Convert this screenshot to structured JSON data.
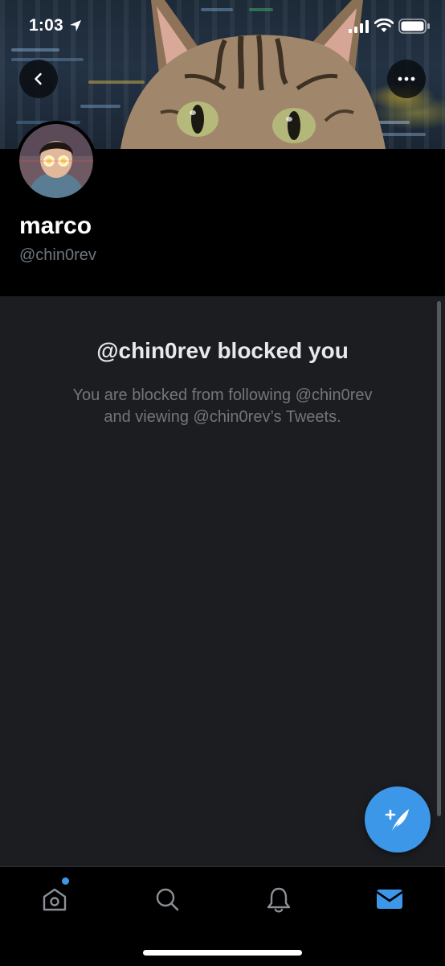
{
  "status_bar": {
    "time": "1:03"
  },
  "header": {
    "back_icon": "chevron-left-icon",
    "more_icon": "more-horizontal-icon"
  },
  "profile": {
    "name": "marco",
    "handle": "@chin0rev"
  },
  "blocked": {
    "title": "@chin0rev blocked you",
    "desc_line1": "You are blocked from following @chin0rev",
    "desc_line2": "and viewing @chin0rev’s Tweets."
  },
  "fab": {
    "icon": "compose-tweet-icon"
  },
  "bottom_nav": {
    "items": [
      {
        "icon": "home-icon",
        "active": false
      },
      {
        "icon": "search-icon",
        "active": false
      },
      {
        "icon": "bell-icon",
        "active": false
      },
      {
        "icon": "mail-icon",
        "active": true
      }
    ]
  },
  "colors": {
    "accent": "#3d97e8",
    "panel_bg": "#1c1d21",
    "muted_text": "#71767b"
  }
}
